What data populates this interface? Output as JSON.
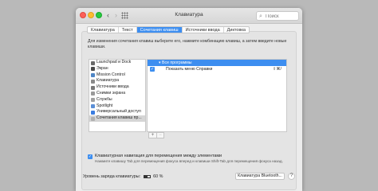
{
  "window": {
    "title": "Клавиатура"
  },
  "nav": {
    "back": "‹",
    "forward": "›"
  },
  "search": {
    "placeholder": "Поиск"
  },
  "tabs": [
    {
      "label": "Клавиатура",
      "active": false
    },
    {
      "label": "Текст",
      "active": false
    },
    {
      "label": "Сочетания клавиш",
      "active": true
    },
    {
      "label": "Источники ввода",
      "active": false
    },
    {
      "label": "Диктовка",
      "active": false
    }
  ],
  "description": "Для изменения сочетания клавиш выберите его, нажмите комбинацию клавиш, а затем введите новые клавиши.",
  "categories": [
    {
      "label": "Launchpad и Dock",
      "icon_color": "#6a6a6a"
    },
    {
      "label": "Экран",
      "icon_color": "#4a4a4a"
    },
    {
      "label": "Mission Control",
      "icon_color": "#4f86c6"
    },
    {
      "label": "Клавиатура",
      "icon_color": "#8a8a8a"
    },
    {
      "label": "Источники ввода",
      "icon_color": "#777777"
    },
    {
      "label": "Снимки экрана",
      "icon_color": "#9a9a9a"
    },
    {
      "label": "Службы",
      "icon_color": "#a0a0a0"
    },
    {
      "label": "Spotlight",
      "icon_color": "#5b8fd6"
    },
    {
      "label": "Универсальный доступ",
      "icon_color": "#3b7de0"
    },
    {
      "label": "Сочетания клавиш пр...",
      "icon_color": "#b0b0b0",
      "selected": true
    }
  ],
  "shortcuts": [
    {
      "label": "▾ Все программы",
      "selected": true,
      "checked": false,
      "key": ""
    },
    {
      "label": "Показать меню Справки",
      "selected": false,
      "checked": true,
      "key": "⇧⌘/"
    }
  ],
  "pm": {
    "plus": "+",
    "minus": "−"
  },
  "keyboard_nav": {
    "label": "Клавиатурная навигация для перемещения между элементами",
    "checked": true,
    "note": "Нажмите клавишу Tab для перемещения фокуса вперед и клавиши Shift-Tab для перемещения фокуса назад."
  },
  "battery": {
    "label": "Уровень заряда клавиатуры:",
    "percent_text": "60 %",
    "level": 0.6
  },
  "bluetooth_button": "Клавиатура Bluetooth...",
  "help": "?"
}
